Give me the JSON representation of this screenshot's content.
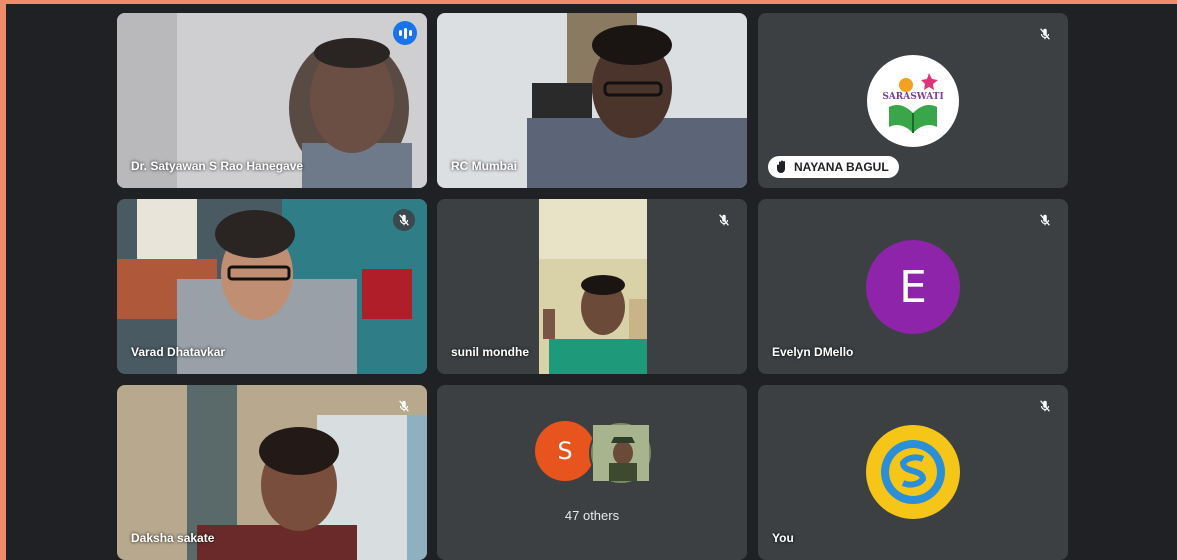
{
  "participants": [
    {
      "name": "Dr. Satyawan S Rao Hanegave",
      "speaking": true,
      "has_video": true
    },
    {
      "name": "RC Mumbai",
      "has_video": true
    },
    {
      "name": "NAYANA BAGUL",
      "logo_text": "SARASWATI",
      "hand_raised": true,
      "muted": true
    },
    {
      "name": "Varad Dhatavkar",
      "has_video": true,
      "muted": true
    },
    {
      "name": "sunil mondhe",
      "has_video": true,
      "muted": true
    },
    {
      "name": "Evelyn DMello",
      "avatar_letter": "E",
      "avatar_color": "#8e24aa",
      "muted": true
    },
    {
      "name": "Daksha sakate",
      "has_video": true,
      "muted": true
    },
    {
      "group": true,
      "avatar_letter": "S",
      "avatar_color": "#e8541e",
      "others_label": "47 others"
    },
    {
      "name": "You",
      "muted": true
    }
  ],
  "colors": {
    "background": "#202124",
    "tile": "#3c4043",
    "accent": "#1a73e8",
    "active_border": "#8ab4f8"
  }
}
